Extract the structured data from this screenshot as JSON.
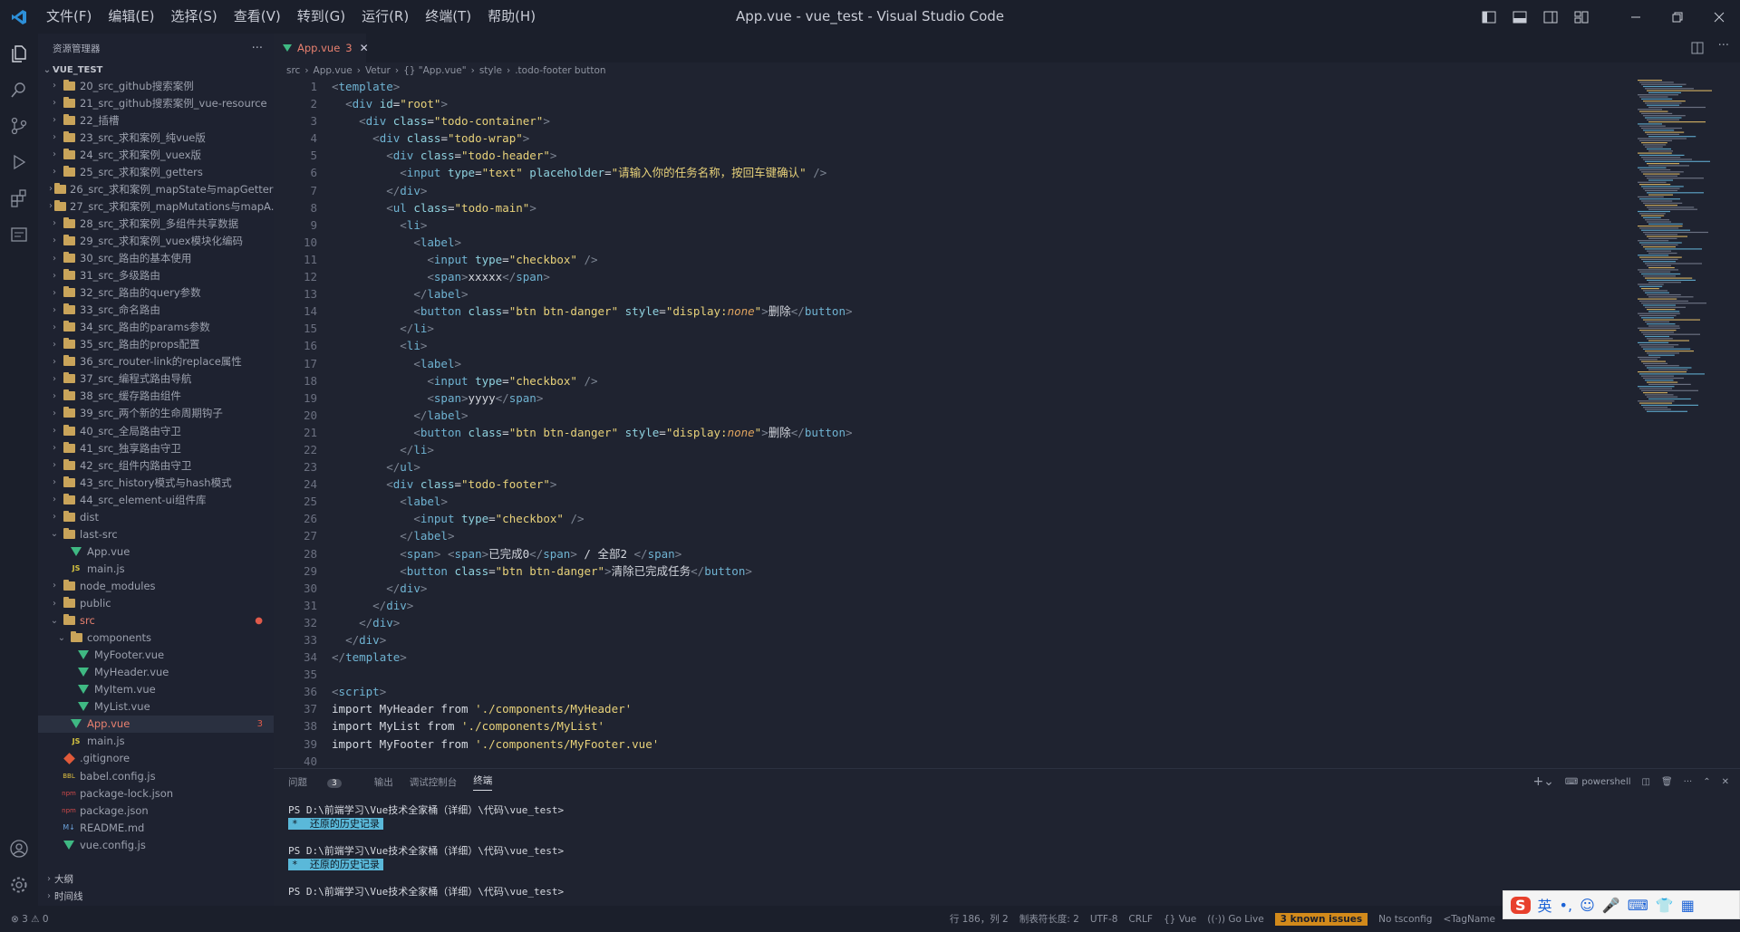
{
  "titlebar": {
    "menus": [
      "文件(F)",
      "编辑(E)",
      "选择(S)",
      "查看(V)",
      "转到(G)",
      "运行(R)",
      "终端(T)",
      "帮助(H)"
    ],
    "title": "App.vue - vue_test - Visual Studio Code"
  },
  "sidebar": {
    "title": "资源管理器",
    "root": "VUE_TEST",
    "items": [
      "20_src_github搜索案例",
      "21_src_github搜索案例_vue-resource",
      "22_插槽",
      "23_src_求和案例_纯vue版",
      "24_src_求和案例_vuex版",
      "25_src_求和案例_getters",
      "26_src_求和案例_mapState与mapGetters",
      "27_src_求和案例_mapMutations与mapA...",
      "28_src_求和案例_多组件共享数据",
      "29_src_求和案例_vuex模块化编码",
      "30_src_路由的基本使用",
      "31_src_多级路由",
      "32_src_路由的query参数",
      "33_src_命名路由",
      "34_src_路由的params参数",
      "35_src_路由的props配置",
      "36_src_router-link的replace属性",
      "37_src_编程式路由导航",
      "38_src_缓存路由组件",
      "39_src_两个新的生命周期钩子",
      "40_src_全局路由守卫",
      "41_src_独享路由守卫",
      "42_src_组件内路由守卫",
      "43_src_history模式与hash模式",
      "44_src_element-ui组件库",
      "dist",
      "last-src",
      "App.vue",
      "main.js",
      "node_modules",
      "public",
      "src",
      "components",
      "MyFooter.vue",
      "MyHeader.vue",
      "MyItem.vue",
      "MyList.vue",
      "App.vue",
      "main.js",
      ".gitignore",
      "babel.config.js",
      "package-lock.json",
      "package.json",
      "README.md",
      "vue.config.js"
    ],
    "outline": "大纲",
    "timeline": "时间线",
    "src_badge": "●",
    "app_badge": "3"
  },
  "tab": {
    "label": "App.vue",
    "count": "3"
  },
  "breadcrumb": [
    "src",
    "App.vue",
    "Vetur",
    "{} \"App.vue\"",
    "style",
    ".todo-footer button"
  ],
  "panel": {
    "tabs": [
      "问题",
      "输出",
      "调试控制台",
      "终端"
    ],
    "problems_count": "3",
    "shell": "powershell",
    "terminal": [
      {
        "prompt": "PS D:\\前端学习\\Vue技术全家桶（详细）\\代码\\vue_test>",
        "note": "还原的历史记录"
      },
      {
        "prompt": "PS D:\\前端学习\\Vue技术全家桶（详细）\\代码\\vue_test>",
        "note": "还原的历史记录"
      },
      {
        "prompt": "PS D:\\前端学习\\Vue技术全家桶（详细）\\代码\\vue_test>",
        "note": ""
      }
    ]
  },
  "status": {
    "errors": "⊗ 3 ⚠ 0",
    "position": "行 186，列 2",
    "tabsize": "制表符长度: 2",
    "encoding": "UTF-8",
    "eol": "CRLF",
    "lang": "{} Vue",
    "golive": "Go Live",
    "issues": "3 known issues",
    "tsconfig": "No tsconfig",
    "tagname": "<TagName"
  },
  "ime": {
    "lang": "英"
  }
}
